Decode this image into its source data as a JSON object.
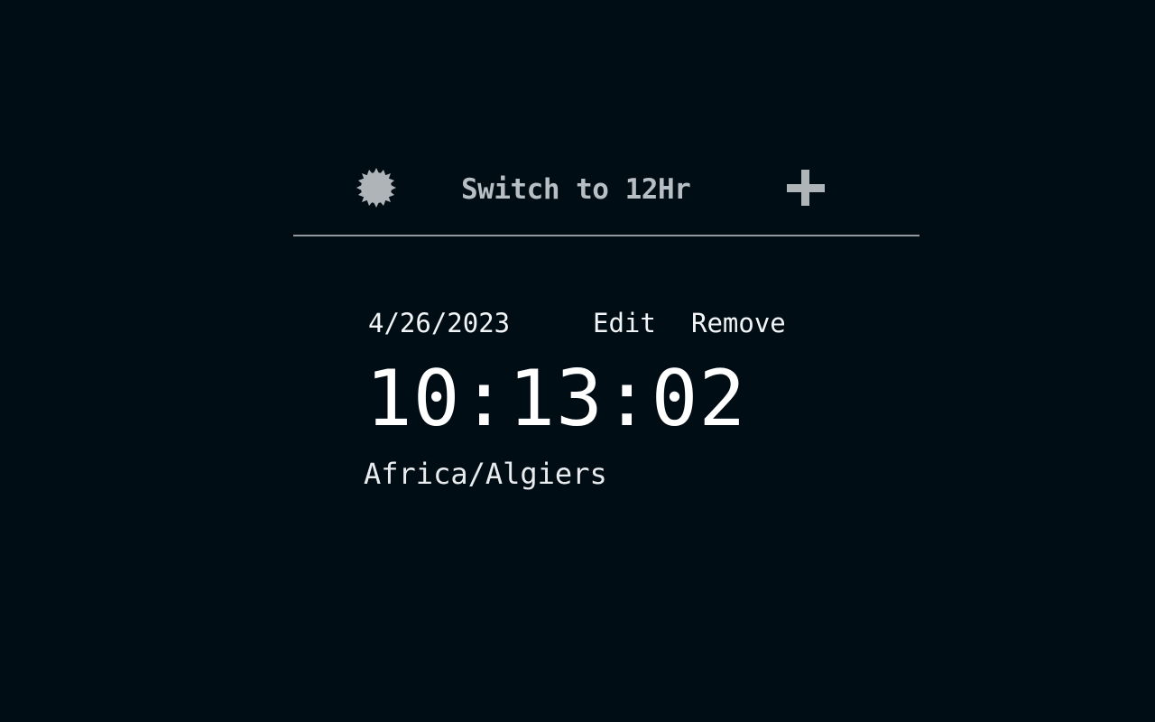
{
  "toolbar": {
    "theme_icon": "sun-icon",
    "switch_label": "Switch to 12Hr",
    "add_icon": "plus-icon"
  },
  "clock": {
    "date": "4/26/2023",
    "edit_label": "Edit",
    "remove_label": "Remove",
    "time": "10:13:02",
    "timezone": "Africa/Algiers"
  },
  "colors": {
    "background": "#010d14",
    "toolbar_text": "#b7bec4",
    "divider": "#93999e",
    "clock_text": "#ffffff"
  }
}
